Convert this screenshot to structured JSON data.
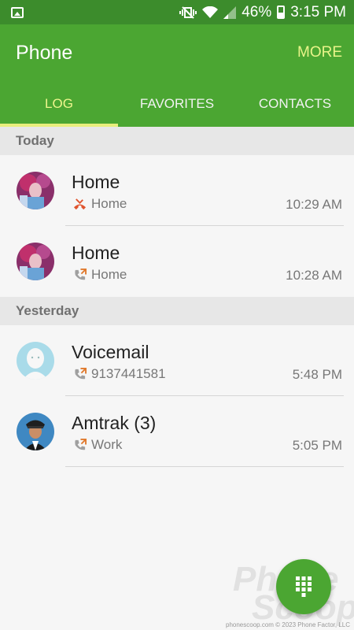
{
  "status_bar": {
    "battery": "46%",
    "time": "3:15 PM",
    "icons": [
      "image-icon",
      "vibrate-icon",
      "wifi-icon",
      "signal-icon",
      "battery-icon"
    ]
  },
  "app_bar": {
    "title": "Phone",
    "more_label": "MORE"
  },
  "tabs": [
    {
      "label": "LOG",
      "active": true
    },
    {
      "label": "FAVORITES",
      "active": false
    },
    {
      "label": "CONTACTS",
      "active": false
    }
  ],
  "sections": [
    {
      "header": "Today",
      "entries": [
        {
          "name": "Home",
          "call_type": "missed",
          "detail": "Home",
          "time": "10:29 AM",
          "avatar": "photo-avatar"
        },
        {
          "name": "Home",
          "call_type": "outgoing",
          "detail": "Home",
          "time": "10:28 AM",
          "avatar": "photo-avatar"
        }
      ]
    },
    {
      "header": "Yesterday",
      "entries": [
        {
          "name": "Voicemail",
          "call_type": "outgoing",
          "detail": "9137441581",
          "time": "5:48 PM",
          "avatar": "default-person-avatar"
        },
        {
          "name": "Amtrak (3)",
          "call_type": "outgoing",
          "detail": "Work",
          "time": "5:05 PM",
          "avatar": "conductor-avatar"
        }
      ]
    }
  ],
  "fab": {
    "icon": "dialpad-icon"
  },
  "watermark": {
    "line1": "Phone",
    "line2": "Scoop"
  },
  "credit": "phonescoop.com  © 2023 Phone Factor, LLC",
  "colors": {
    "status_bar": "#3c8c2c",
    "app_bar": "#4ba632",
    "active_tab": "#eef58d",
    "missed": "#e0542e",
    "outgoing": "#e07a2e"
  }
}
